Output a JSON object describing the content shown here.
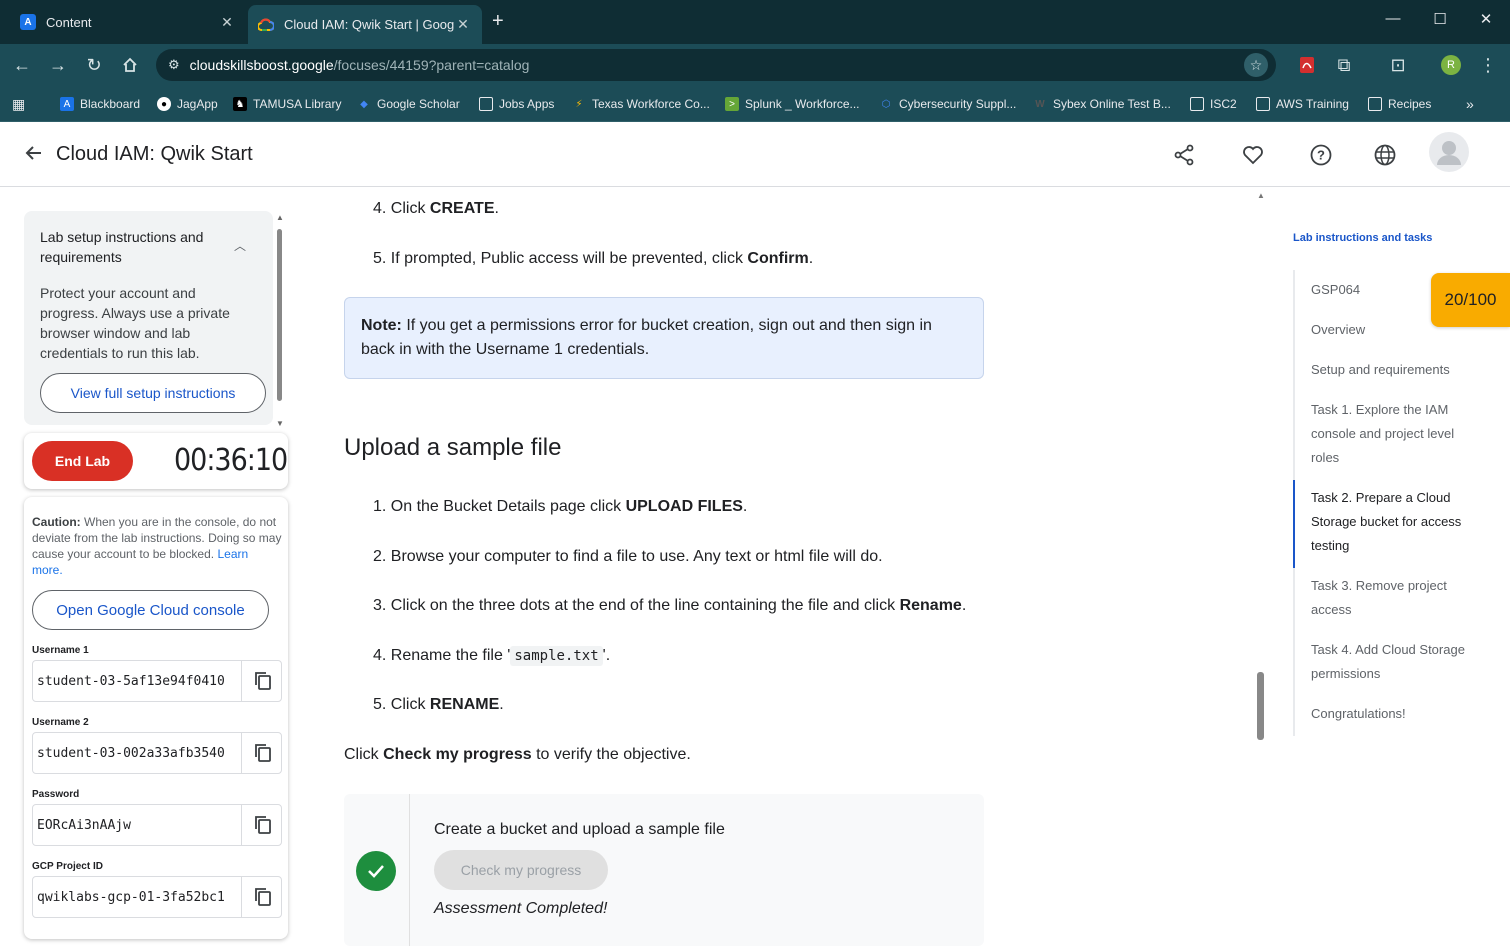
{
  "browser": {
    "tabs": [
      {
        "title": "Content",
        "favicon": "A"
      },
      {
        "title": "Cloud IAM: Qwik Start | Google",
        "favicon": "cloud"
      }
    ],
    "url_host": "cloudskillsboost.google",
    "url_path": "/focuses/44159?parent=catalog",
    "bookmarks": [
      "Blackboard",
      "JagApp",
      "TAMUSA Library",
      "Google Scholar",
      "Jobs Apps",
      "Texas Workforce Co...",
      "Splunk _ Workforce...",
      "Cybersecurity Suppl...",
      "Sybex Online Test B...",
      "ISC2",
      "AWS Training",
      "Recipes"
    ],
    "profile_initial": "R"
  },
  "header": {
    "title": "Cloud IAM: Qwik Start"
  },
  "setup": {
    "title": "Lab setup instructions and requirements",
    "body": "Protect your account and progress. Always use a private browser window and lab credentials to run this lab.",
    "view_button": "View full setup instructions"
  },
  "lab": {
    "end_button": "End Lab",
    "timer": "00:36:10",
    "caution_label": "Caution:",
    "caution_text": "When you are in the console, do not deviate from the lab instructions. Doing so may cause your account to be blocked.",
    "learn_more": "Learn more.",
    "console_button": "Open Google Cloud console",
    "credentials": [
      {
        "label": "Username 1",
        "value": "student-03-5af13e94f0410"
      },
      {
        "label": "Username 2",
        "value": "student-03-002a33afb3540"
      },
      {
        "label": "Password",
        "value": "EORcAi3nAAjw"
      },
      {
        "label": "GCP Project ID",
        "value": "qwiklabs-gcp-01-3fa52bc1"
      }
    ]
  },
  "content": {
    "steps_top": [
      {
        "num": "4.",
        "pre": "Click ",
        "bold": "CREATE",
        "post": "."
      },
      {
        "num": "5.",
        "pre": "If prompted, Public access will be prevented, click ",
        "bold": "Confirm",
        "post": "."
      }
    ],
    "note_label": "Note:",
    "note_line1": " If you get a permissions error for bucket creation, sign out and then sign in",
    "note_line2": "back in with the Username 1 credentials.",
    "section_title": "Upload a sample file",
    "steps": [
      {
        "num": "1.",
        "pre": "On the Bucket Details page click ",
        "bold": "UPLOAD FILES",
        "post": "."
      },
      {
        "num": "2.",
        "pre": "Browse your computer to find a file to use. Any text or html file will do.",
        "bold": "",
        "post": ""
      },
      {
        "num": "3.",
        "pre": "Click on the three dots at the end of the line containing the file and click ",
        "bold": "Rename",
        "post": "."
      },
      {
        "num": "4.",
        "pre": "Rename the file '",
        "code": "sample.txt",
        "post": "'."
      },
      {
        "num": "5.",
        "pre": "Click ",
        "bold": "RENAME",
        "post": "."
      }
    ],
    "check_pre": "Click ",
    "check_bold": "Check my progress",
    "check_post": " to verify the objective.",
    "progress_title": "Create a bucket and upload a sample file",
    "progress_button": "Check my progress",
    "progress_status": "Assessment Completed!"
  },
  "toc": {
    "heading": "Lab instructions and tasks",
    "items": [
      {
        "label": "GSP064"
      },
      {
        "label": "Overview"
      },
      {
        "label": "Setup and requirements"
      },
      {
        "label": "Task 1. Explore the IAM console and project level roles"
      },
      {
        "label": "Task 2. Prepare a Cloud Storage bucket for access testing"
      },
      {
        "label": "Task 3. Remove project access"
      },
      {
        "label": "Task 4. Add Cloud Storage permissions"
      },
      {
        "label": "Congratulations!"
      }
    ],
    "active_index": 4
  },
  "score": "20/100",
  "colors": {
    "accent": "#1a56c9",
    "end_lab": "#d93025",
    "score": "#f9ab00",
    "success": "#1e8e3e"
  }
}
